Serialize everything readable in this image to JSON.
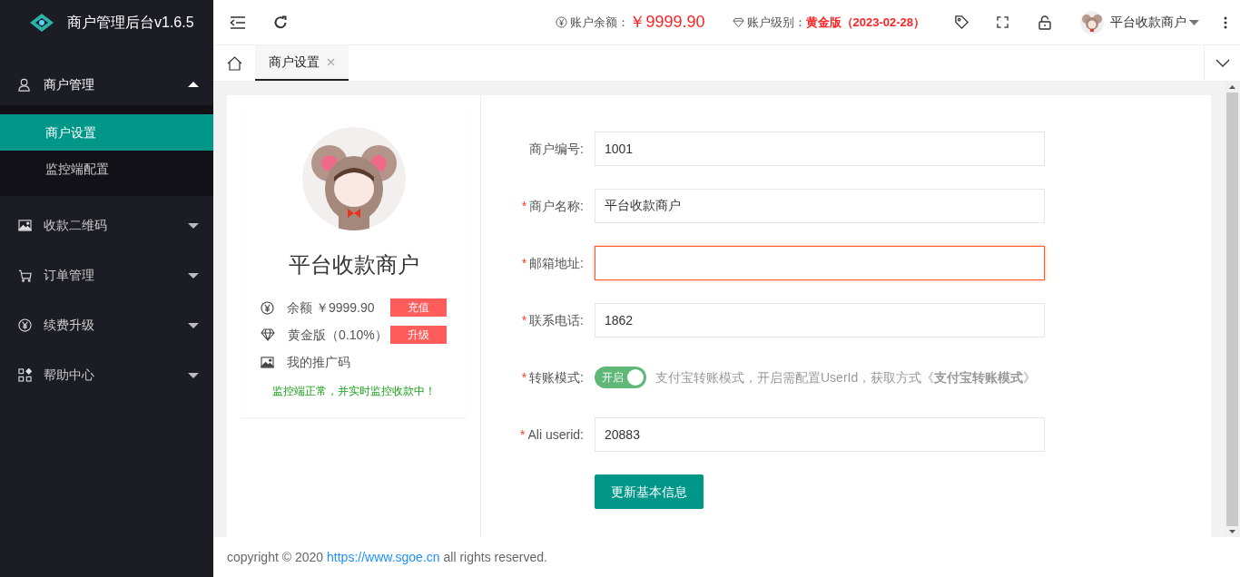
{
  "app": {
    "title": "商户管理后台v1.6.5"
  },
  "sidebar": {
    "items": [
      {
        "label": "商户管理",
        "expanded": true,
        "children": [
          {
            "label": "商户设置",
            "selected": true
          },
          {
            "label": "监控端配置",
            "selected": false
          }
        ]
      },
      {
        "label": "收款二维码",
        "expanded": false
      },
      {
        "label": "订单管理",
        "expanded": false
      },
      {
        "label": "续费升级",
        "expanded": false
      },
      {
        "label": "帮助中心",
        "expanded": false
      }
    ]
  },
  "header": {
    "balance_label": "账户余额：",
    "balance_value": "￥9999.90",
    "level_label": "账户级别：",
    "level_value": "黄金版（2023-02-28）",
    "user_name": "平台收款商户"
  },
  "tabs": [
    {
      "label": "商户设置",
      "selected": true
    }
  ],
  "profile": {
    "name": "平台收款商户",
    "stats": [
      {
        "text": "余额 ￥9999.90",
        "action": "充值"
      },
      {
        "text": "黄金版（0.10%）",
        "action": "升级"
      },
      {
        "text": "我的推广码"
      }
    ],
    "status": "监控端正常，并实时监控收款中！"
  },
  "form": {
    "fields": [
      {
        "kind": "text",
        "label": "商户编号:",
        "value": "1001",
        "invalid": false
      },
      {
        "kind": "text",
        "label": "商户名称:",
        "required_mark": "*",
        "value": "平台收款商户",
        "invalid": false
      },
      {
        "kind": "text",
        "label": "邮箱地址:",
        "required_mark": "*",
        "invalid": true
      },
      {
        "kind": "text",
        "label": "联系电话:",
        "required_mark": "*",
        "value": "1862",
        "invalid": false
      },
      {
        "kind": "toggle",
        "label": "转账模式:",
        "required_mark": "*",
        "on": true,
        "toggle_text": "开启",
        "hint": "支付宝转账模式，开启需配置UserId，获取方式《**支付宝转账模式**》"
      },
      {
        "kind": "text",
        "label": "Ali userid:",
        "required_mark": "*",
        "value": "20883",
        "invalid": false
      }
    ],
    "submit": "更新基本信息"
  },
  "footer": {
    "text_before": "copyright © 2020",
    "link": "https://www.sgoe.cn",
    "text_after": "all rights reserved."
  }
}
